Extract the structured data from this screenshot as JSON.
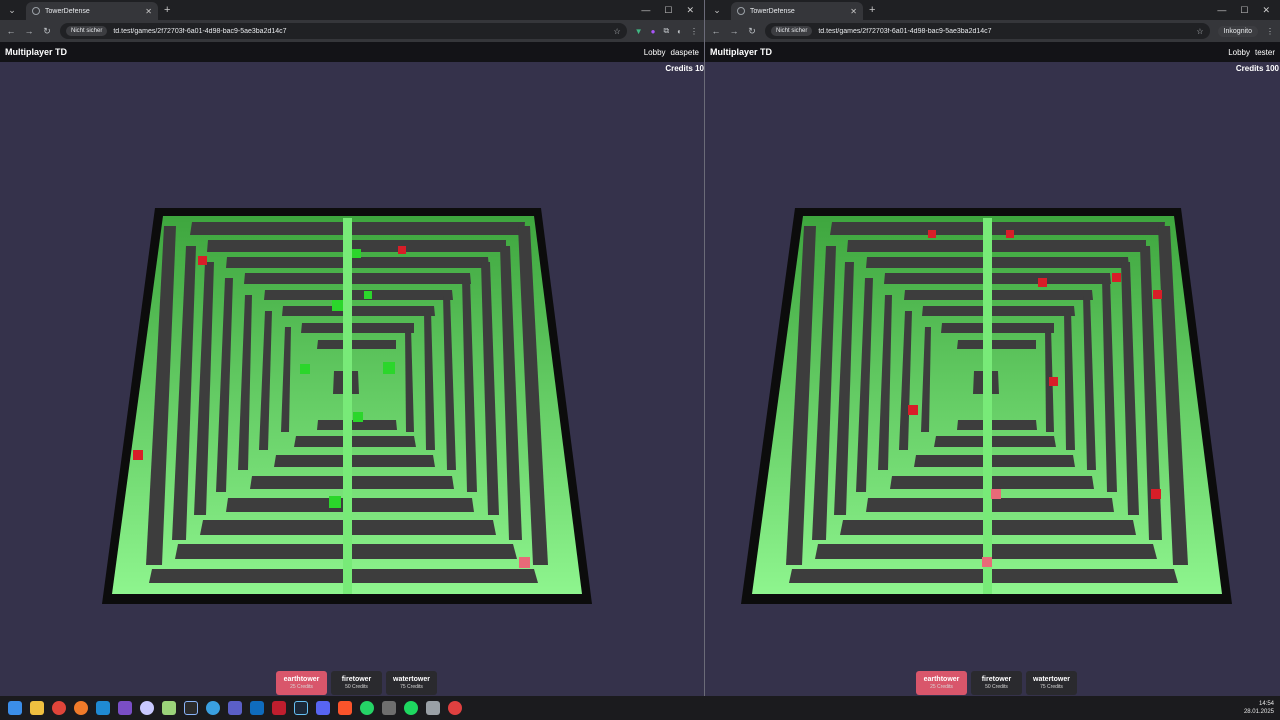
{
  "windows": [
    {
      "tab_title": "TowerDefense",
      "security_label": "Nicht sicher",
      "url": "td.test/games/2f72703f-6a01-4d98-bac9-5ae3ba2d14c7",
      "app_title": "Multiplayer TD",
      "lobby_label": "Lobby",
      "username": "daspete",
      "credits": "Credits 10",
      "towers": [
        {
          "name": "earthtower",
          "cost": "25 Credits"
        },
        {
          "name": "firetower",
          "cost": "50 Credits"
        },
        {
          "name": "watertower",
          "cost": "75 Credits"
        }
      ]
    },
    {
      "tab_title": "TowerDefense",
      "security_label": "Nicht sicher",
      "url": "td.test/games/2f72703f-6a01-4d98-bac9-5ae3ba2d14c7",
      "incognito_label": "Inkognito",
      "app_title": "Multiplayer TD",
      "lobby_label": "Lobby",
      "username": "tester",
      "credits": "Credits 100",
      "towers": [
        {
          "name": "earthtower",
          "cost": "25 Credits"
        },
        {
          "name": "firetower",
          "cost": "50 Credits"
        },
        {
          "name": "watertower",
          "cost": "75 Credits"
        }
      ]
    }
  ],
  "taskbar": {
    "time": "14:54",
    "date": "28.01.2025",
    "icons": [
      "windows-start-icon",
      "file-explorer-icon",
      "chrome-icon",
      "firefox-icon",
      "vscode-icon",
      "visual-studio-icon",
      "app-icon",
      "notepad-icon",
      "terminal-icon",
      "browser-icon",
      "teams-icon",
      "outlook-icon",
      "filezilla-icon",
      "steam-icon",
      "discord-icon",
      "brave-icon",
      "whatsapp-icon",
      "virtualbox-icon",
      "spotify-icon",
      "calculator-icon",
      "recorder-icon"
    ]
  },
  "colors": {
    "background": "#35324b",
    "path_green": "#5fe05f",
    "wall": "#4a4a4a",
    "enemy_red": "#e0202a",
    "tower_green": "#2ee02e",
    "active_button": "#d9566b"
  }
}
